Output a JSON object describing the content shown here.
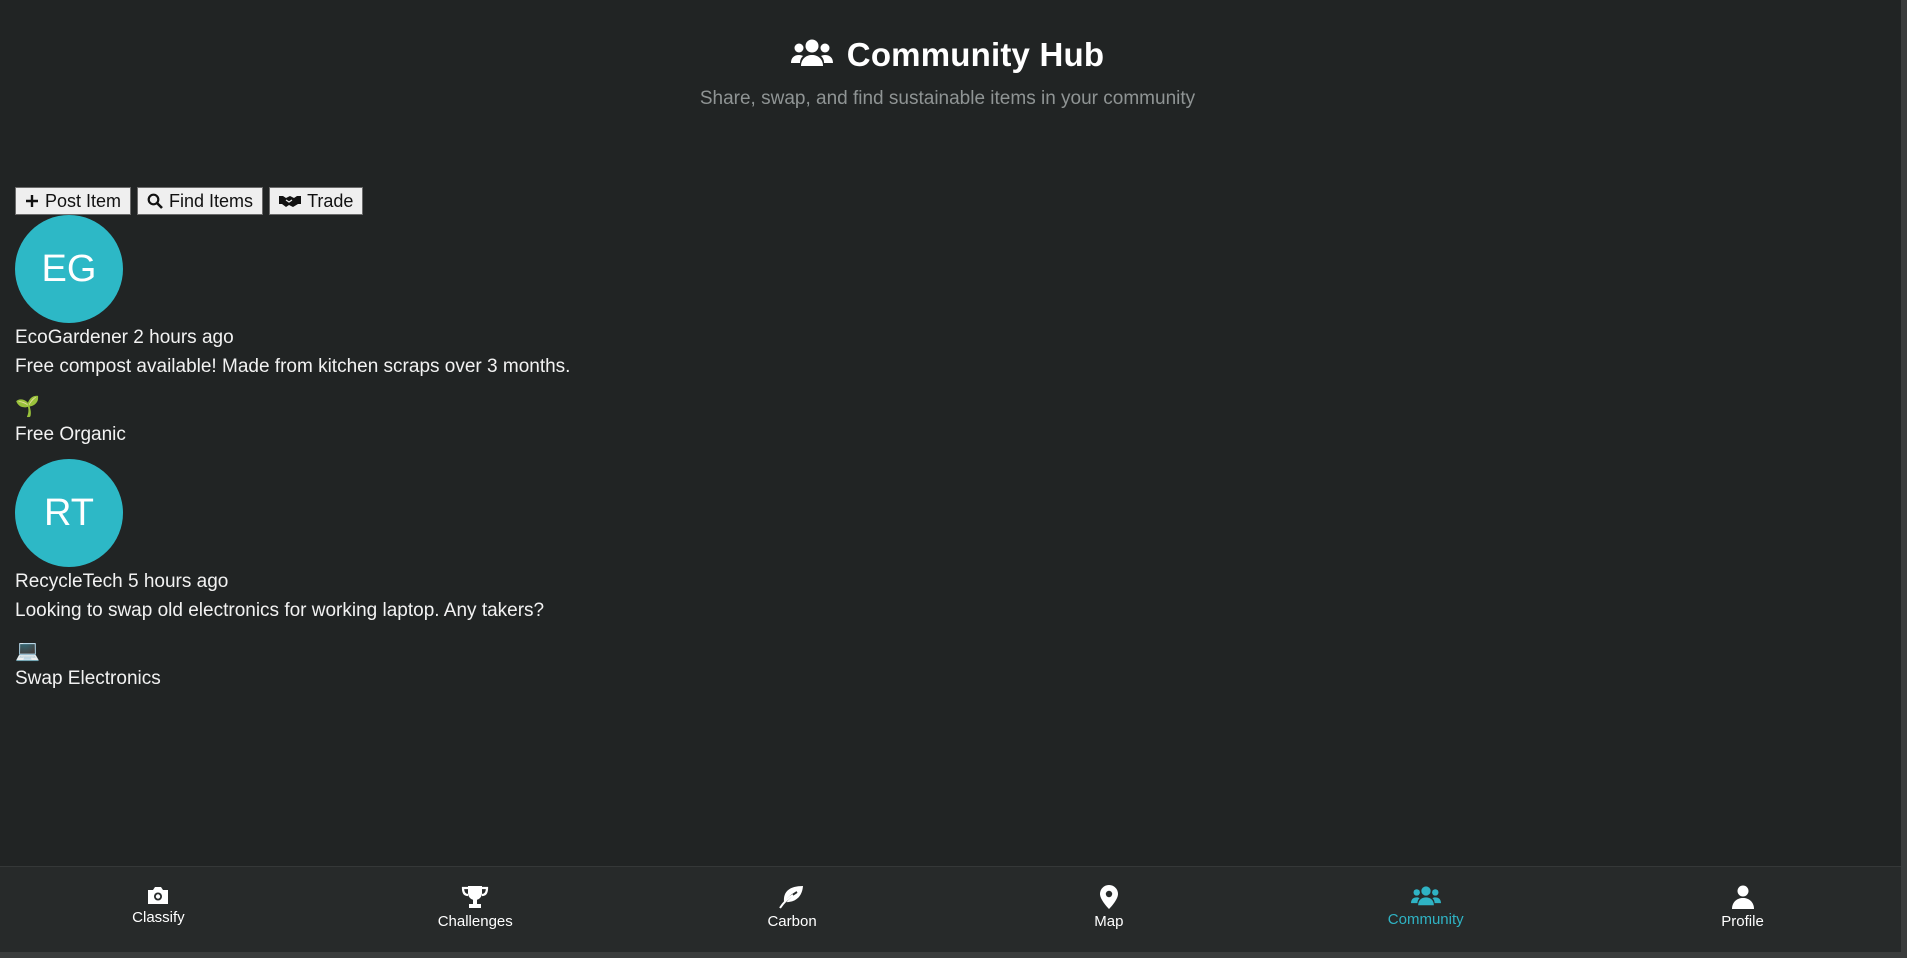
{
  "header": {
    "title": "Community Hub",
    "subtitle": "Share, swap, and find sustainable items in your community",
    "icon": "users-icon"
  },
  "actions": [
    {
      "label": "Post Item",
      "icon": "plus-icon"
    },
    {
      "label": "Find Items",
      "icon": "search-icon"
    },
    {
      "label": "Trade",
      "icon": "handshake-icon"
    }
  ],
  "posts": [
    {
      "initials": "EG",
      "meta": "EcoGardener 2 hours ago",
      "text": "Free compost available! Made from kitchen scraps over 3 months.",
      "emoji": "🌱",
      "tags": "Free Organic"
    },
    {
      "initials": "RT",
      "meta": "RecycleTech 5 hours ago",
      "text": "Looking to swap old electronics for working laptop. Any takers?",
      "emoji": "💻",
      "tags": "Swap Electronics"
    }
  ],
  "nav": [
    {
      "label": "Classify",
      "icon": "camera-icon"
    },
    {
      "label": "Challenges",
      "icon": "trophy-icon"
    },
    {
      "label": "Carbon",
      "icon": "leaf-icon"
    },
    {
      "label": "Map",
      "icon": "map-pin-icon"
    },
    {
      "label": "Community",
      "icon": "users-icon",
      "active": true
    },
    {
      "label": "Profile",
      "icon": "user-icon"
    }
  ],
  "colors": {
    "background": "#212424",
    "accent": "#2fb3c4",
    "avatar": "#2db8c6"
  }
}
